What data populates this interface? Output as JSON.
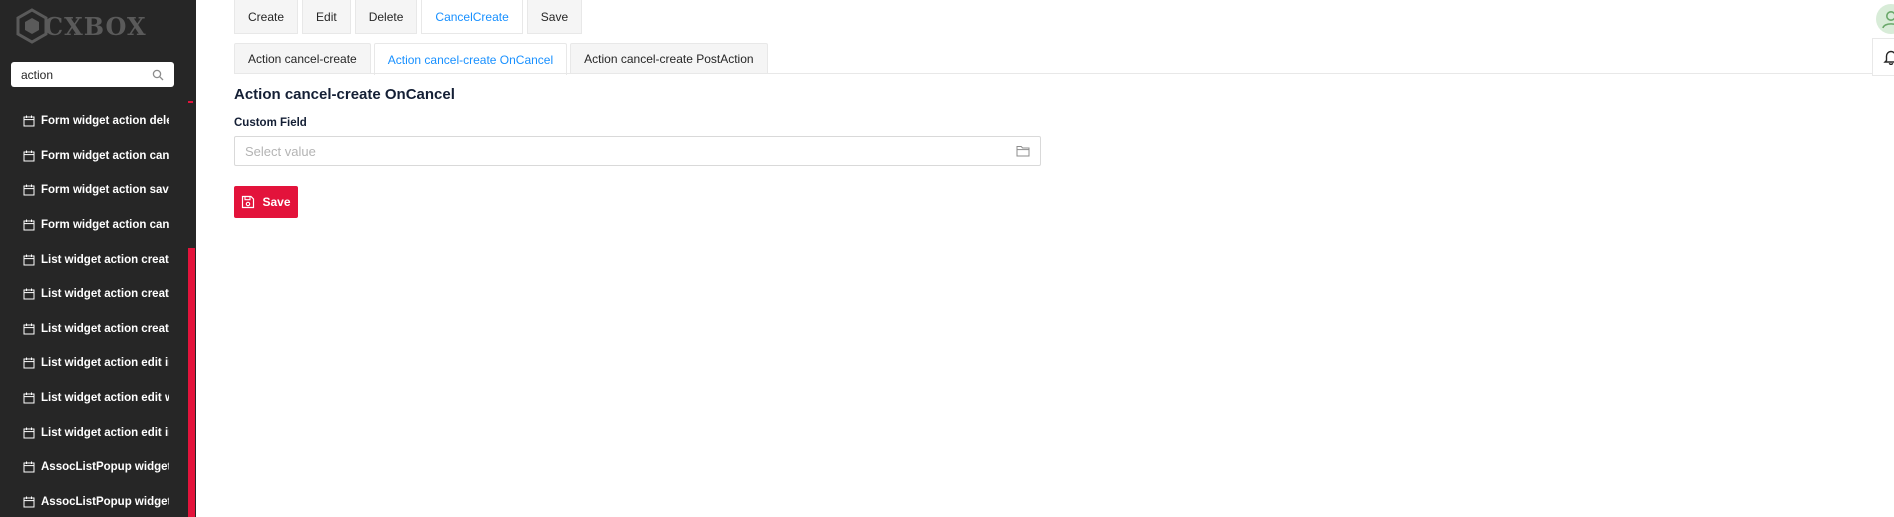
{
  "app": {
    "logo_text": "CXBOX"
  },
  "sidebar": {
    "search": {
      "value": "action",
      "placeholder": ""
    },
    "items": [
      {
        "label": "Form widget action delete"
      },
      {
        "label": "Form widget action cancel-create"
      },
      {
        "label": "Form widget action save"
      },
      {
        "label": "Form widget action cancel-create"
      },
      {
        "label": "List widget action create"
      },
      {
        "label": "List widget action create"
      },
      {
        "label": "List widget action create"
      },
      {
        "label": "List widget action edit inline"
      },
      {
        "label": "List widget action edit with"
      },
      {
        "label": "List widget action edit inline"
      },
      {
        "label": "AssocListPopup widget action"
      },
      {
        "label": "AssocListPopup widget action"
      }
    ]
  },
  "toolbar": {
    "buttons": [
      {
        "label": "Create"
      },
      {
        "label": "Edit"
      },
      {
        "label": "Delete"
      },
      {
        "label": "CancelCreate",
        "active": true
      },
      {
        "label": "Save"
      }
    ]
  },
  "tabs": [
    {
      "label": "Action cancel-create"
    },
    {
      "label": "Action cancel-create OnCancel",
      "active": true
    },
    {
      "label": "Action cancel-create PostAction"
    }
  ],
  "form": {
    "title": "Action cancel-create OnCancel",
    "field_label": "Custom Field",
    "field_value": "",
    "field_placeholder": "Select value",
    "save_label": "Save"
  },
  "colors": {
    "sidebar_bg": "#262626",
    "accent_red": "#e3133b",
    "active_blue": "#1890ff"
  },
  "icons": {
    "search": "search-icon",
    "menu_item": "calendar-icon",
    "field": "folder-icon",
    "save": "save-icon",
    "user": "user-icon",
    "notifications": "bell-icon"
  }
}
